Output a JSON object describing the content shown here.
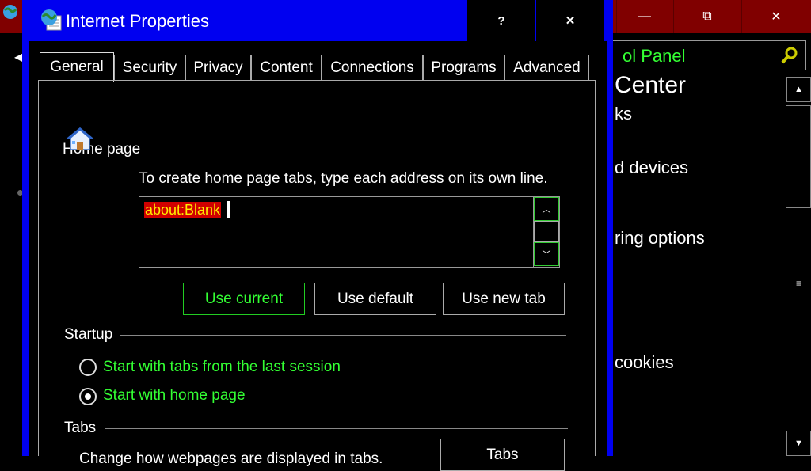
{
  "background_window": {
    "search_text": "ol Panel",
    "heading": "Center",
    "lines": [
      "ks",
      "d devices",
      "ring options",
      "cookies"
    ],
    "controls": {
      "minimize": "—",
      "maximize": "⧉",
      "close": "✕"
    },
    "back": "◀"
  },
  "dialog": {
    "title": "Internet Properties",
    "help": "?",
    "close": "✕",
    "tabs": [
      "General",
      "Security",
      "Privacy",
      "Content",
      "Connections",
      "Programs",
      "Advanced"
    ],
    "active_tab": "General"
  },
  "home_page": {
    "label": "Home page",
    "instruction": "To create home page tabs, type each address on its own line.",
    "value": "about:Blank",
    "buttons": {
      "use_current": "Use current",
      "use_default": "Use default",
      "use_new_tab": "Use new tab"
    }
  },
  "startup": {
    "label": "Startup",
    "options": [
      {
        "label": "Start with tabs from the last session",
        "selected": false
      },
      {
        "label": "Start with home page",
        "selected": true
      }
    ]
  },
  "tabs_section": {
    "label": "Tabs",
    "description": "Change how webpages are displayed in tabs.",
    "button": "Tabs"
  },
  "colors": {
    "dialog_frame": "#0000f0",
    "bg_titlebar": "#800000",
    "highlight_text": "#33ff33",
    "selection_bg": "#d00000",
    "selection_text": "#ffee00"
  },
  "icons": [
    "globe-icon",
    "house-icon",
    "search-icon",
    "back-arrow-icon"
  ]
}
